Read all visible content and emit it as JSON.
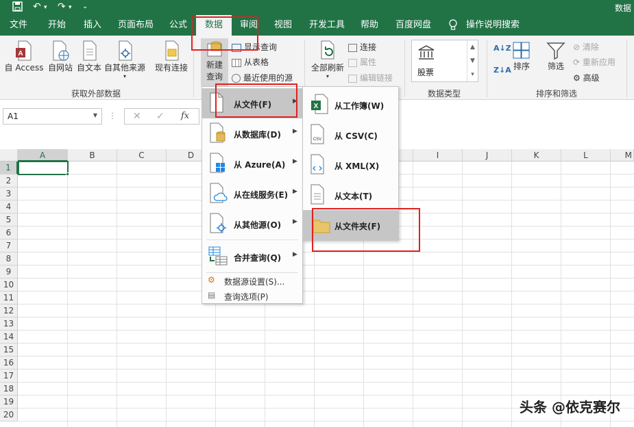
{
  "window": {
    "title": "数据"
  },
  "tabs": [
    "文件",
    "开始",
    "插入",
    "页面布局",
    "公式",
    "数据",
    "审阅",
    "视图",
    "开发工具",
    "帮助",
    "百度网盘",
    "操作说明搜索"
  ],
  "active_tab": "数据",
  "ribbon": {
    "get_external": {
      "buttons": [
        "自 Access",
        "自网站",
        "自文本",
        "自其他来源",
        "现有连接"
      ],
      "group_label": "获取外部数据"
    },
    "new_query": {
      "label_line1": "新建",
      "label_line2": "查询"
    },
    "query_small": [
      "显示查询",
      "从表格",
      "最近使用的源"
    ],
    "refresh_all": "全部刷新",
    "connections_small": [
      "连接",
      "属性",
      "编辑链接"
    ],
    "data_types": {
      "gallery_item": "股票",
      "group_label": "数据类型"
    },
    "sort_filter": {
      "sort": "排序",
      "filter": "筛选",
      "clear": "清除",
      "reapply": "重新应用",
      "advanced": "高级",
      "group_label": "排序和筛选"
    }
  },
  "formula_bar": {
    "name_box": "A1",
    "fx": "fx"
  },
  "grid": {
    "columns": [
      "A",
      "B",
      "C",
      "D",
      "I",
      "J",
      "K",
      "L",
      "M"
    ],
    "rows": [
      "1",
      "2",
      "3",
      "4",
      "5",
      "6",
      "7",
      "8",
      "9",
      "10",
      "11",
      "12",
      "13",
      "14",
      "15",
      "16",
      "17",
      "18",
      "19",
      "20"
    ]
  },
  "menu_main": {
    "items": [
      "从文件(F)",
      "从数据库(D)",
      "从 Azure(A)",
      "从在线服务(E)",
      "从其他源(O)",
      "合并查询(Q)"
    ],
    "small_items": [
      "数据源设置(S)...",
      "查询选项(P)"
    ]
  },
  "menu_sub": {
    "items": [
      "从工作簿(W)",
      "从 CSV(C)",
      "从 XML(X)",
      "从文本(T)",
      "从文件夹(F)"
    ]
  },
  "colors": {
    "excel_green": "#217346",
    "highlight_red": "#e02020",
    "menu_hover": "#c6c6c6"
  },
  "watermark": "头条 @依克赛尔"
}
